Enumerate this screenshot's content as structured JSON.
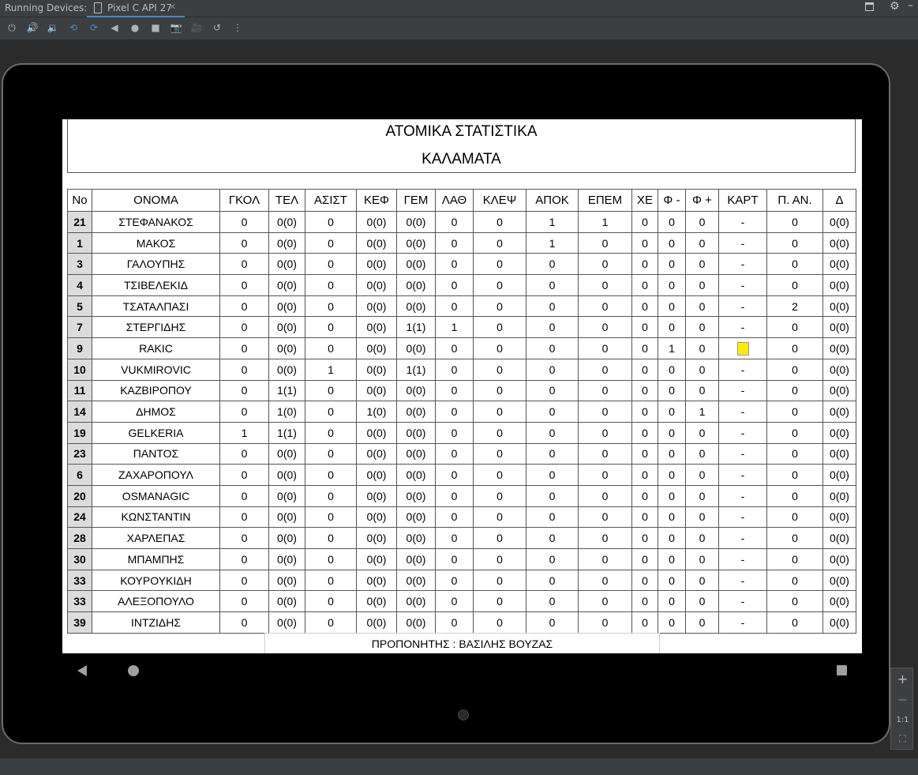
{
  "ide": {
    "tool_window_label": "Running Devices:",
    "device_tab_label": "Pixel C API 27",
    "zoom_in": "+",
    "zoom_out": "−",
    "zoom_actual": "1:1"
  },
  "report": {
    "title": "ΑΤΟΜΙΚΑ ΣΤΑΤΙΣΤΙΚΑ",
    "team": "ΚΑΛΑΜΑΤΑ",
    "coach": "ΠΡΟΠΟΝΗΤΗΣ : ΒΑΣΙΛΗΣ ΒΟΥΖΑΣ",
    "columns": [
      "No",
      "ΟΝΟΜΑ",
      "ΓΚΟΛ",
      "ΤΕΛ",
      "ΑΣΙΣΤ",
      "ΚΕΦ",
      "ΓΕΜ",
      "ΛΑΘ",
      "ΚΛΕΨ",
      "ΑΠΟΚ",
      "ΕΠΕΜ",
      "ΧΕ",
      "Φ -",
      "Φ +",
      "ΚΑΡΤ",
      "Π. ΑΝ.",
      "Δ"
    ],
    "rows": [
      [
        "21",
        "ΣΤΕΦΑΝΑΚΟΣ",
        "0",
        "0(0)",
        "0",
        "0(0)",
        "0(0)",
        "0",
        "0",
        "1",
        "1",
        "0",
        "0",
        "0",
        "-",
        "0",
        "0(0)"
      ],
      [
        "1",
        "ΜΑΚΟΣ",
        "0",
        "0(0)",
        "0",
        "0(0)",
        "0(0)",
        "0",
        "0",
        "1",
        "0",
        "0",
        "0",
        "0",
        "-",
        "0",
        "0(0)"
      ],
      [
        "3",
        "ΓΑΛΟΥΠΗΣ",
        "0",
        "0(0)",
        "0",
        "0(0)",
        "0(0)",
        "0",
        "0",
        "0",
        "0",
        "0",
        "0",
        "0",
        "-",
        "0",
        "0(0)"
      ],
      [
        "4",
        "ΤΣΙΒΕΛΕΚΙΔ",
        "0",
        "0(0)",
        "0",
        "0(0)",
        "0(0)",
        "0",
        "0",
        "0",
        "0",
        "0",
        "0",
        "0",
        "-",
        "0",
        "0(0)"
      ],
      [
        "5",
        "ΤΣΑΤΑΛΠΑΣΙ",
        "0",
        "0(0)",
        "0",
        "0(0)",
        "0(0)",
        "0",
        "0",
        "0",
        "0",
        "0",
        "0",
        "0",
        "-",
        "2",
        "0(0)"
      ],
      [
        "7",
        "ΣΤΕΡΓΙΔΗΣ",
        "0",
        "0(0)",
        "0",
        "0(0)",
        "1(1)",
        "1",
        "0",
        "0",
        "0",
        "0",
        "0",
        "0",
        "-",
        "0",
        "0(0)"
      ],
      [
        "9",
        "RAKIC",
        "0",
        "0(0)",
        "0",
        "0(0)",
        "0(0)",
        "0",
        "0",
        "0",
        "0",
        "0",
        "1",
        "0",
        "yellow",
        "0",
        "0(0)"
      ],
      [
        "10",
        "VUKMIROVIC",
        "0",
        "0(0)",
        "1",
        "0(0)",
        "1(1)",
        "0",
        "0",
        "0",
        "0",
        "0",
        "0",
        "0",
        "-",
        "0",
        "0(0)"
      ],
      [
        "11",
        "ΚΑΖΒΙΡΟΠΟΥ",
        "0",
        "1(1)",
        "0",
        "0(0)",
        "0(0)",
        "0",
        "0",
        "0",
        "0",
        "0",
        "0",
        "0",
        "-",
        "0",
        "0(0)"
      ],
      [
        "14",
        "ΔΗΜΟΣ",
        "0",
        "1(0)",
        "0",
        "1(0)",
        "0(0)",
        "0",
        "0",
        "0",
        "0",
        "0",
        "0",
        "1",
        "-",
        "0",
        "0(0)"
      ],
      [
        "19",
        "GELKERIA",
        "1",
        "1(1)",
        "0",
        "0(0)",
        "0(0)",
        "0",
        "0",
        "0",
        "0",
        "0",
        "0",
        "0",
        "-",
        "0",
        "0(0)"
      ],
      [
        "23",
        "ΠΑΝΤΟΣ",
        "0",
        "0(0)",
        "0",
        "0(0)",
        "0(0)",
        "0",
        "0",
        "0",
        "0",
        "0",
        "0",
        "0",
        "-",
        "0",
        "0(0)"
      ],
      [
        "6",
        "ΖΑΧΑΡΟΠΟΥΛ",
        "0",
        "0(0)",
        "0",
        "0(0)",
        "0(0)",
        "0",
        "0",
        "0",
        "0",
        "0",
        "0",
        "0",
        "-",
        "0",
        "0(0)"
      ],
      [
        "20",
        "OSMANAGIC",
        "0",
        "0(0)",
        "0",
        "0(0)",
        "0(0)",
        "0",
        "0",
        "0",
        "0",
        "0",
        "0",
        "0",
        "-",
        "0",
        "0(0)"
      ],
      [
        "24",
        "ΚΩΝΣΤΑΝΤΙΝ",
        "0",
        "0(0)",
        "0",
        "0(0)",
        "0(0)",
        "0",
        "0",
        "0",
        "0",
        "0",
        "0",
        "0",
        "-",
        "0",
        "0(0)"
      ],
      [
        "28",
        "ΧΑΡΛΕΠΑΣ",
        "0",
        "0(0)",
        "0",
        "0(0)",
        "0(0)",
        "0",
        "0",
        "0",
        "0",
        "0",
        "0",
        "0",
        "-",
        "0",
        "0(0)"
      ],
      [
        "30",
        "ΜΠΑΜΠΗΣ",
        "0",
        "0(0)",
        "0",
        "0(0)",
        "0(0)",
        "0",
        "0",
        "0",
        "0",
        "0",
        "0",
        "0",
        "-",
        "0",
        "0(0)"
      ],
      [
        "33",
        "ΚΟΥΡΟΥΚΙΔΗ",
        "0",
        "0(0)",
        "0",
        "0(0)",
        "0(0)",
        "0",
        "0",
        "0",
        "0",
        "0",
        "0",
        "0",
        "-",
        "0",
        "0(0)"
      ],
      [
        "33",
        "ΑΛΕΞΟΠΟΥΛΟ",
        "0",
        "0(0)",
        "0",
        "0(0)",
        "0(0)",
        "0",
        "0",
        "0",
        "0",
        "0",
        "0",
        "0",
        "-",
        "0",
        "0(0)"
      ],
      [
        "39",
        "ΙΝΤΖΙΔΗΣ",
        "0",
        "0(0)",
        "0",
        "0(0)",
        "0(0)",
        "0",
        "0",
        "0",
        "0",
        "0",
        "0",
        "0",
        "-",
        "0",
        "0(0)"
      ]
    ]
  },
  "colors": {
    "yellow_card": "#ffeb00",
    "number_cell_bg": "#dcdcdc"
  }
}
